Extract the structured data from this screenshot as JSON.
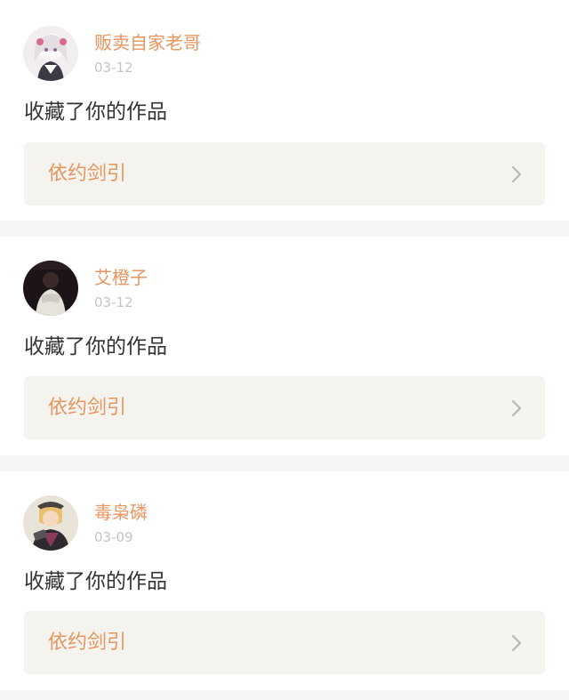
{
  "notifications": [
    {
      "user": "贩卖自家老哥",
      "date": "03-12",
      "action": "收藏了你的作品",
      "work_title": "依约剑引",
      "avatar_icon": "anime-girl-avatar"
    },
    {
      "user": "艾橙子",
      "date": "03-12",
      "action": "收藏了你的作品",
      "work_title": "依约剑引",
      "avatar_icon": "dark-photo-avatar"
    },
    {
      "user": "毒枭磷",
      "date": "03-09",
      "action": "收藏了你的作品",
      "work_title": "依约剑引",
      "avatar_icon": "anime-boy-avatar"
    }
  ],
  "colors": {
    "accent": "#e8955f",
    "date": "#c4c4c4",
    "link_bg": "#f4f3ee",
    "divider": "#f7f5f3"
  }
}
